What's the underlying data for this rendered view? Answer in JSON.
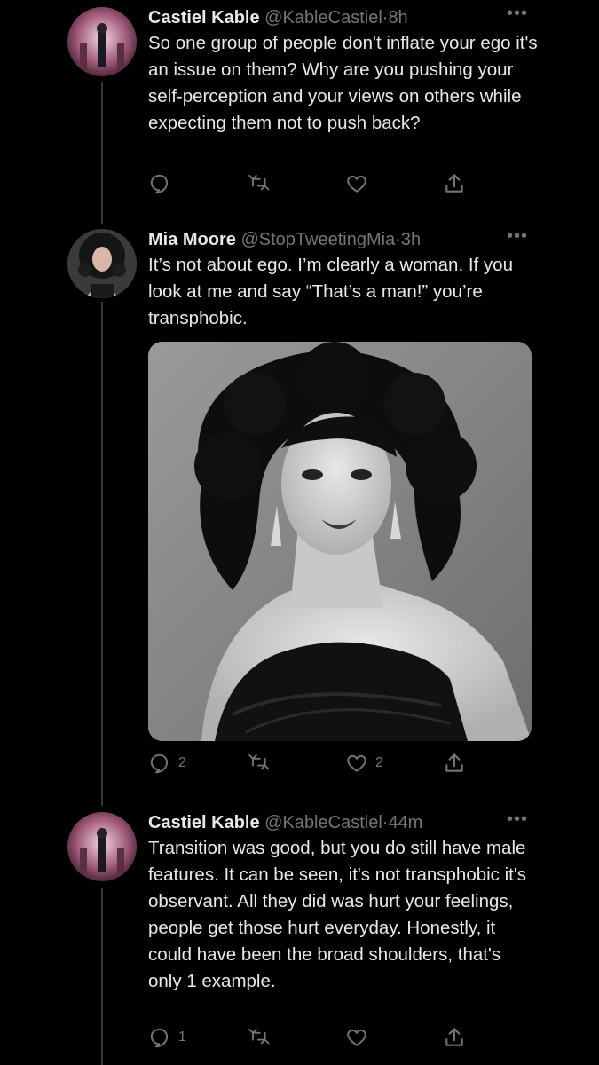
{
  "tweets": [
    {
      "name": "Castiel Kable",
      "handle": "@KableCastiel",
      "sep": "·",
      "time": "8h",
      "text": "So one group of people don't inflate your ego it's an issue on them? Why are you pushing your self-perception and your views on others while expecting them not to push back?",
      "reply_count": "",
      "like_count": ""
    },
    {
      "name": "Mia Moore",
      "handle": "@StopTweetingMia",
      "sep": "·",
      "time": "3h",
      "text": "It’s not about ego. I’m clearly a woman. If you look at me and say “That’s a man!” you’re transphobic.",
      "reply_count": "2",
      "like_count": "2"
    },
    {
      "name": "Castiel Kable",
      "handle": "@KableCastiel",
      "sep": "·",
      "time": "44m",
      "text": "Transition was good, but you do still have male features. It can be seen, it's not transphobic it's observant. All they did was hurt your feelings, people get those hurt everyday. Honestly, it could have been the broad shoulders, that's only 1 example.",
      "reply_count": "1",
      "like_count": ""
    }
  ],
  "more_icon": "more-dots-icon",
  "colors": {
    "background": "#000000",
    "text": "#e7e9ea",
    "muted": "#71767b",
    "line": "#333639"
  }
}
